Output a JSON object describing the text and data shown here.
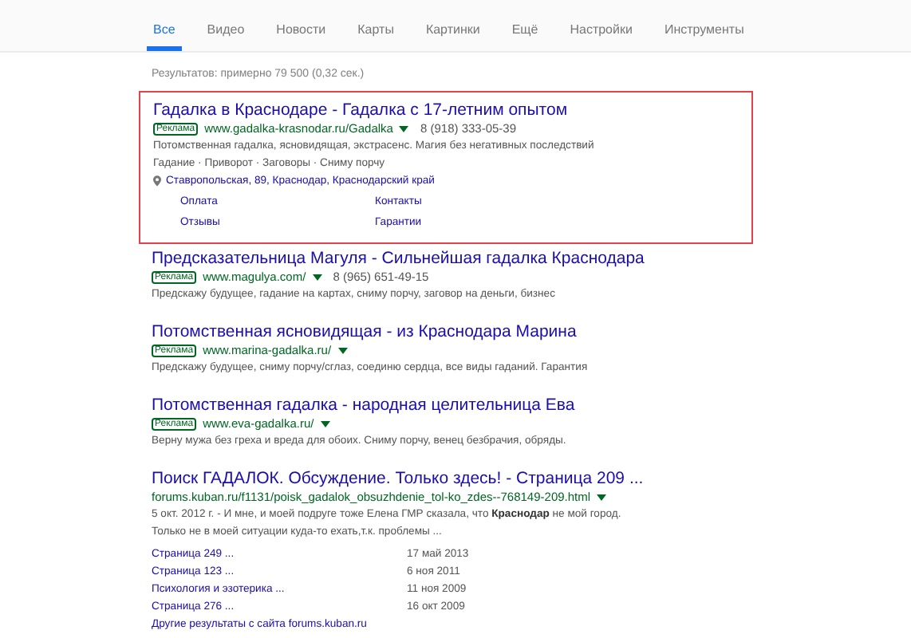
{
  "tabs": [
    {
      "label": "Все",
      "selected": true
    },
    {
      "label": "Видео",
      "selected": false
    },
    {
      "label": "Новости",
      "selected": false
    },
    {
      "label": "Карты",
      "selected": false
    },
    {
      "label": "Картинки",
      "selected": false
    },
    {
      "label": "Ещё",
      "selected": false
    }
  ],
  "tools": [
    "Настройки",
    "Инструменты"
  ],
  "stats": "Результатов: примерно 79 500 (0,32 сек.)",
  "results": [
    {
      "highlighted": true,
      "title": "Гадалка в Краснодаре - Гадалка с 17-летним опытом",
      "ad_label": "Реклама",
      "url": "www.gadalka-krasnodar.ru/Gadalka",
      "phone": "8 (918) 333-05-39",
      "lines": [
        "Потомственная гадалка, ясновидящая, экстрасенс. Магия без негативных последствий",
        "Гадание · Приворот · Заговоры · Сниму порчу"
      ],
      "address": "Ставропольская, 89, Краснодар, Краснодарский край",
      "sitelinks": [
        "Оплата",
        "Контакты",
        "Отзывы",
        "Гарантии"
      ]
    },
    {
      "highlighted": false,
      "title": "Предсказательница Магуля - Сильнейшая гадалка Краснодара",
      "ad_label": "Реклама",
      "url": "www.magulya.com/",
      "phone": "8 (965) 651-49-15",
      "lines": [
        "Предскажу будущее, гадание на картах, сниму порчу, заговор на деньги, бизнес"
      ]
    },
    {
      "highlighted": false,
      "title": "Потомственная ясновидящая - из Краснодара Марина",
      "ad_label": "Реклама",
      "url": "www.marina-gadalka.ru/",
      "lines": [
        "Предскажу будущее, сниму порчу/сглаз, соединю сердца, все виды гаданий. Гарантия"
      ]
    },
    {
      "highlighted": false,
      "title": "Потомственная гадалка - народная целительница Ева",
      "ad_label": "Реклама",
      "url": "www.eva-gadalka.ru/",
      "lines": [
        "Верну мужа без греха и вреда для обоих. Сниму порчу, венец безбрачия, обряды."
      ]
    },
    {
      "highlighted": false,
      "title": "Поиск ГАДАЛОК. Обсуждение. Только здесь! - Страница 209 ...",
      "url": "forums.kuban.ru/f1131/poisk_gadalok_obsuzhdenie_tol-ko_zdes--768149-209.html",
      "lines": [
        "5 окт. 2012 г. - И мне, и моей подруге тоже Елена ГМР сказала, что **Краснодар** не мой город.",
        "Только не в моей ситуации куда-то ехать,т.к. проблемы ..."
      ],
      "subpages": [
        {
          "title": "Страница 249 ...",
          "date": "17 май 2013"
        },
        {
          "title": "Страница 123 ...",
          "date": "6 ноя 2011"
        },
        {
          "title": "Психология и эзотерика ...",
          "date": "11 ноя 2009"
        },
        {
          "title": "Страница 276 ...",
          "date": "16 окт 2009"
        }
      ],
      "more": "Другие результаты с сайта forums.kuban.ru"
    }
  ]
}
